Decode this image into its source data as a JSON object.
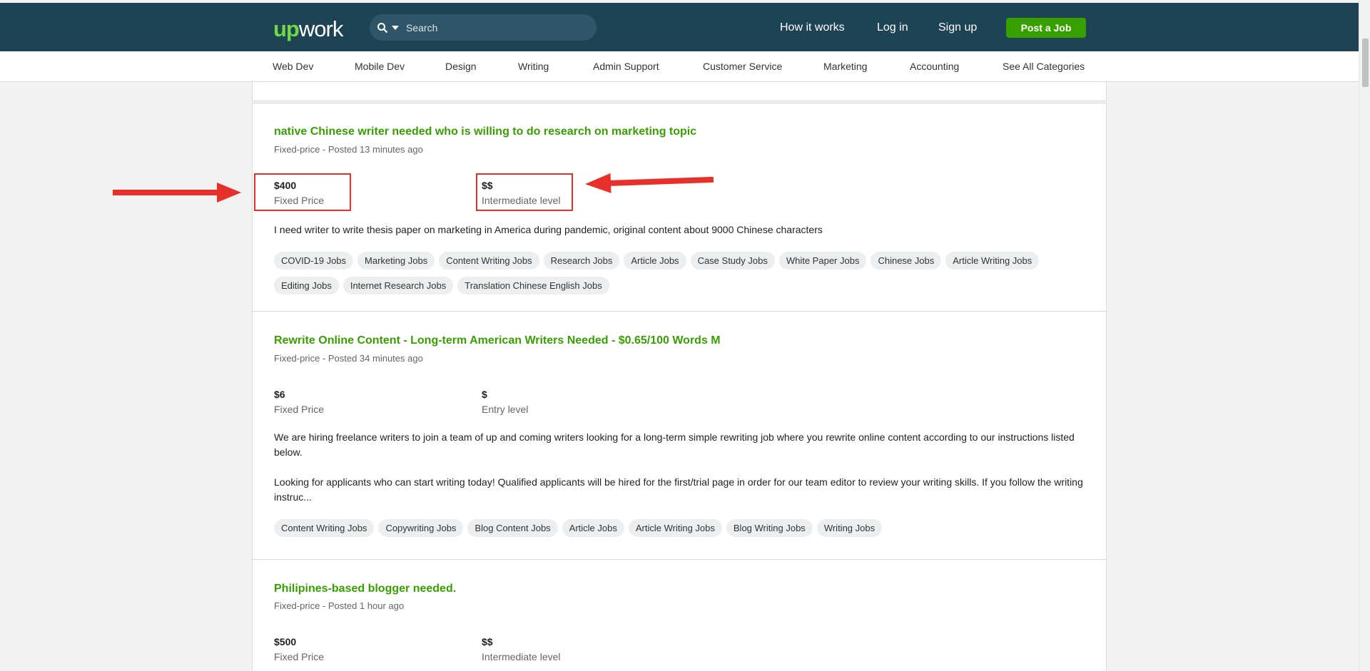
{
  "header": {
    "logo_up": "up",
    "logo_work": "work",
    "search_placeholder": "Search",
    "how_it_works": "How it works",
    "log_in": "Log in",
    "sign_up": "Sign up",
    "post_job": "Post a Job"
  },
  "categories": [
    "Web Dev",
    "Mobile Dev",
    "Design",
    "Writing",
    "Admin Support",
    "Customer Service",
    "Marketing",
    "Accounting",
    "See All Categories"
  ],
  "jobs": [
    {
      "title": "native Chinese writer needed who is willing to do research on marketing topic",
      "meta": "Fixed-price - Posted 13 minutes ago",
      "price": "$400",
      "price_label": "Fixed Price",
      "level_sign": "$$",
      "level": "Intermediate level",
      "description": [
        "I need writer to write thesis paper on marketing in America during pandemic, original content about 9000 Chinese characters"
      ],
      "tags": [
        "COVID-19 Jobs",
        "Marketing Jobs",
        "Content Writing Jobs",
        "Research Jobs",
        "Article Jobs",
        "Case Study Jobs",
        "White Paper Jobs",
        "Chinese Jobs",
        "Article Writing Jobs",
        "Editing Jobs",
        "Internet Research Jobs",
        "Translation Chinese English Jobs"
      ]
    },
    {
      "title": "Rewrite Online Content - Long-term American Writers Needed - $0.65/100 Words M",
      "meta": "Fixed-price - Posted 34 minutes ago",
      "price": "$6",
      "price_label": "Fixed Price",
      "level_sign": "$",
      "level": "Entry level",
      "description": [
        "We are hiring freelance writers to join a team of up and coming writers looking for a long-term simple rewriting job where you rewrite online content according to our instructions listed below.",
        "Looking for applicants who can start writing today! Qualified applicants will be hired for the first/trial page in order for our team editor to review your writing skills. If you follow the writing instruc..."
      ],
      "tags": [
        "Content Writing Jobs",
        "Copywriting Jobs",
        "Blog Content Jobs",
        "Article Jobs",
        "Article Writing Jobs",
        "Blog Writing Jobs",
        "Writing Jobs"
      ]
    },
    {
      "title": "Philipines-based blogger needed.",
      "meta": "Fixed-price - Posted 1 hour ago",
      "price": "$500",
      "price_label": "Fixed Price",
      "level_sign": "$$",
      "level": "Intermediate level"
    }
  ],
  "colors": {
    "header_bg": "#1d4354",
    "brand_green": "#37a000",
    "logo_green": "#6fda44",
    "annotation_red": "#e8302a"
  }
}
